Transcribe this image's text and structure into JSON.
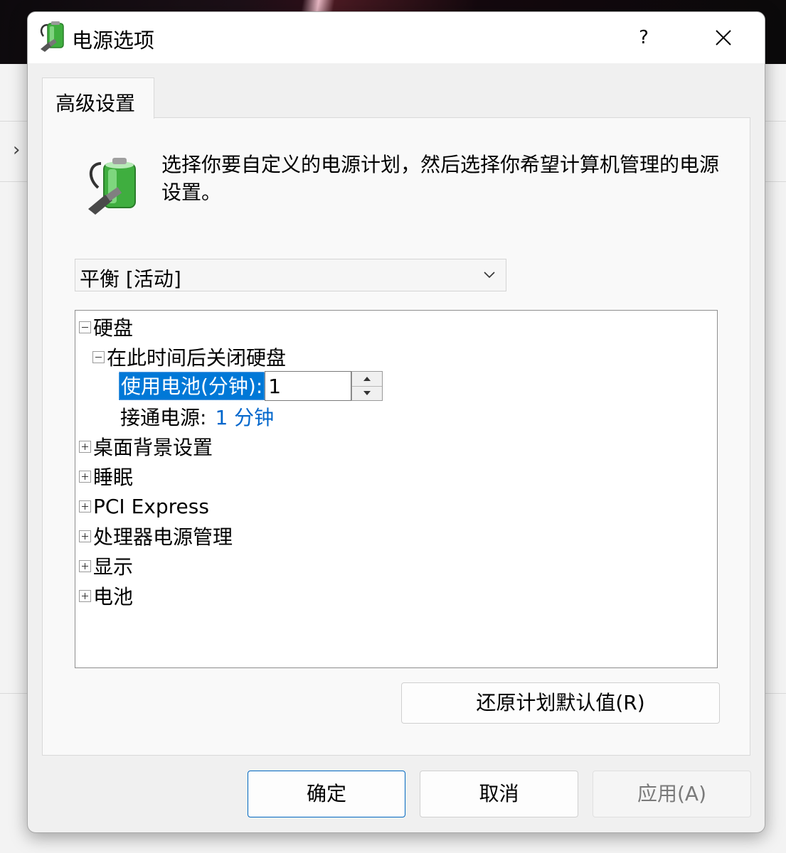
{
  "dialog": {
    "title": "电源选项",
    "help_label": "?",
    "tab_label": "高级设置",
    "description": "选择你要自定义的电源计划，然后选择你希望计算机管理的电源设置。",
    "plan_select": {
      "value": "平衡 [活动]"
    },
    "tree": {
      "nodes": [
        {
          "label": "硬盘"
        },
        {
          "label": "在此时间后关闭硬盘"
        },
        {
          "label": "使用电池(分钟):",
          "value": "1"
        },
        {
          "label": "接通电源:",
          "value": "1 分钟"
        },
        {
          "label": "桌面背景设置"
        },
        {
          "label": "睡眠"
        },
        {
          "label": "PCI Express"
        },
        {
          "label": "处理器电源管理"
        },
        {
          "label": "显示"
        },
        {
          "label": "电池"
        }
      ]
    },
    "restore_button": "还原计划默认值(R)",
    "ok_button": "确定",
    "cancel_button": "取消",
    "apply_button": "应用(A)"
  },
  "colors": {
    "selection": "#0078d7",
    "value_link": "#0066cc",
    "primary_border": "#0067c0"
  }
}
